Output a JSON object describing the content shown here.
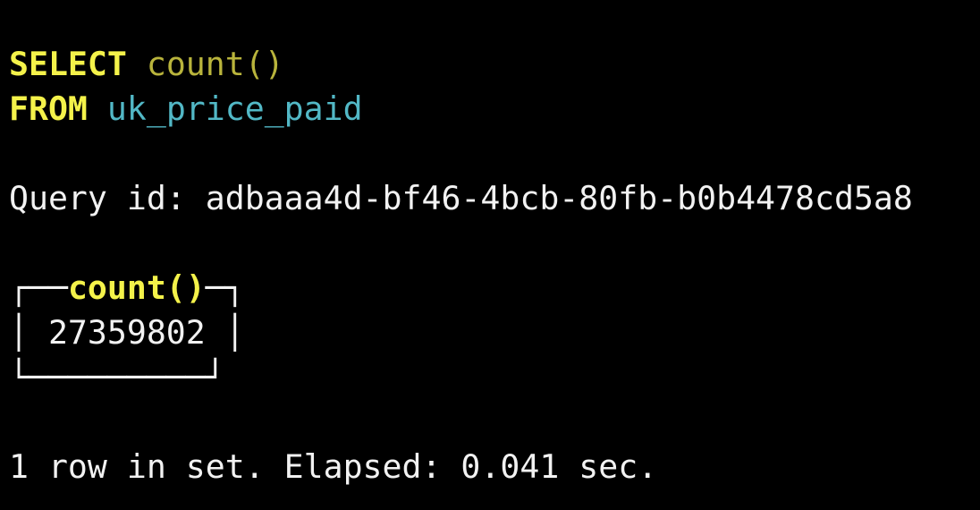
{
  "colors": {
    "background": "#000000",
    "keyword": "#f4f24a",
    "function": "#b9b43c",
    "identifier": "#52b8c6",
    "text": "#f2f2f2"
  },
  "query": {
    "select_kw": "SELECT",
    "select_expr": "count()",
    "from_kw": "FROM",
    "table": "uk_price_paid"
  },
  "query_id_line": "Query id: adbaaa4d-bf46-4bcb-80fb-b0b4478cd5a8",
  "result_table": {
    "top_left": "┌──",
    "column_header": "count()",
    "top_right": "─┐",
    "row_left": "│ ",
    "value": "27359802",
    "row_right": " │",
    "bottom": "└─────────┘"
  },
  "status_line": "1 row in set. Elapsed: 0.041 sec."
}
